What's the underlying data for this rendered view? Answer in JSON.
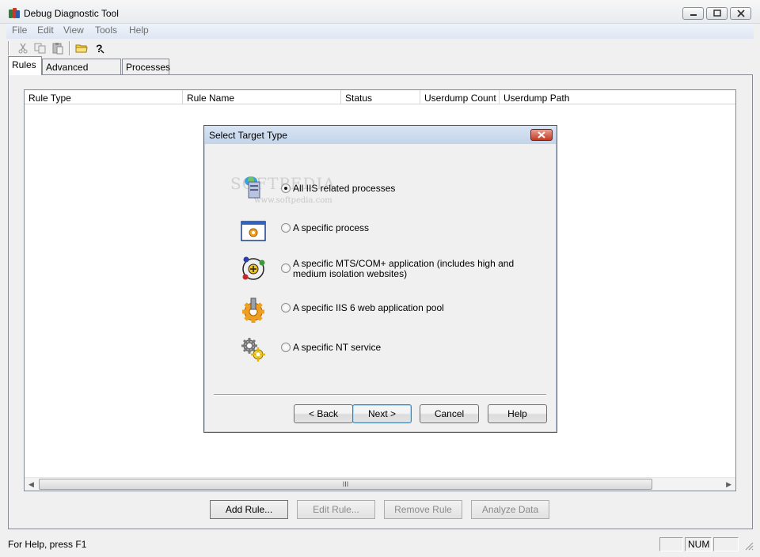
{
  "window": {
    "title": "Debug Diagnostic Tool"
  },
  "menu": [
    "File",
    "Edit",
    "View",
    "Tools",
    "Help"
  ],
  "toolbar": {
    "icons": [
      "cut-icon",
      "copy-icon",
      "paste-icon",
      "open-folder-icon",
      "help-icon"
    ]
  },
  "tabs": [
    {
      "label": "Rules",
      "active": true
    },
    {
      "label": "Advanced Analysis",
      "active": false
    },
    {
      "label": "Processes",
      "active": false
    }
  ],
  "list": {
    "columns": [
      "Rule Type",
      "Rule Name",
      "Status",
      "Userdump Count",
      "Userdump Path"
    ],
    "scroll_grip": "III"
  },
  "actions": {
    "add_rule": "Add Rule...",
    "edit_rule": "Edit Rule...",
    "remove_rule": "Remove Rule",
    "analyze_data": "Analyze Data"
  },
  "status": {
    "text": "For Help, press F1",
    "num": "NUM"
  },
  "dialog": {
    "title": "Select Target Type",
    "watermark": "SOFTPEDIA",
    "watermark_url": "www.softpedia.com",
    "options": [
      {
        "label": "All IIS related processes",
        "checked": true,
        "icon": "iis-server-icon"
      },
      {
        "label": "A specific process",
        "checked": false,
        "icon": "process-window-icon"
      },
      {
        "label": "A specific MTS/COM+ application (includes high and medium isolation websites)",
        "checked": false,
        "icon": "com-plus-icon"
      },
      {
        "label": "A specific IIS 6 web application pool",
        "checked": false,
        "icon": "app-pool-gear-icon"
      },
      {
        "label": "A specific NT service",
        "checked": false,
        "icon": "nt-service-gears-icon"
      }
    ],
    "buttons": {
      "back": "< Back",
      "next": "Next >",
      "cancel": "Cancel",
      "help": "Help"
    }
  },
  "colors": {
    "dialog_frame": "#c5d5ea",
    "close_button": "#c23a22",
    "menu_bar": "#dfe7f3"
  }
}
